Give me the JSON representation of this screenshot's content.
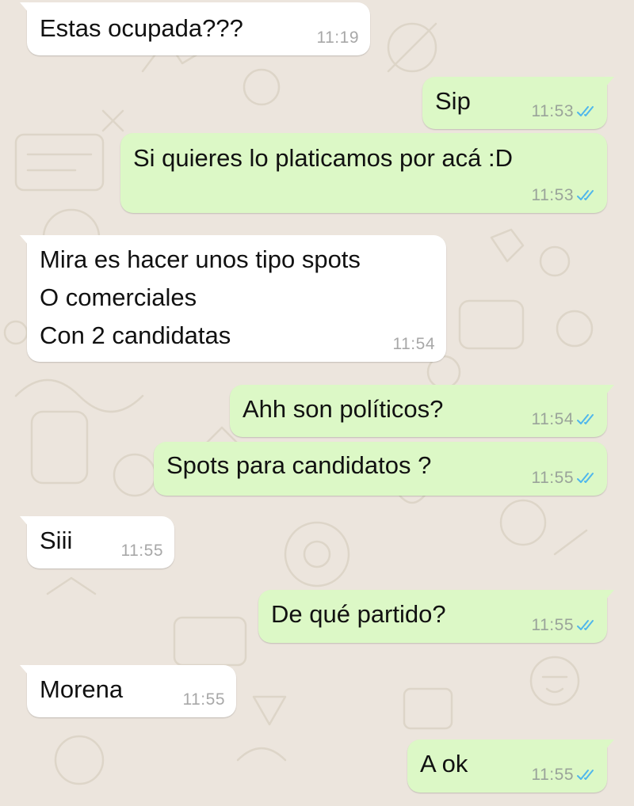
{
  "colors": {
    "wallpaper": "#ece5dd",
    "incoming_bubble": "#ffffff",
    "outgoing_bubble": "#dcf8c6",
    "read_ticks": "#4fb6ec"
  },
  "messages": [
    {
      "direction": "incoming",
      "text": "Estas ocupada???",
      "time": "11:19"
    },
    {
      "direction": "outgoing",
      "text": "Sip",
      "time": "11:53",
      "status": "read"
    },
    {
      "direction": "outgoing",
      "text": "Si quieres lo platicamos por acá :D",
      "time": "11:53",
      "status": "read"
    },
    {
      "direction": "incoming",
      "lines": [
        "Mira es hacer unos tipo spots",
        "O comerciales",
        "Con 2 candidatas"
      ],
      "time": "11:54"
    },
    {
      "direction": "outgoing",
      "text": "Ahh son políticos?",
      "time": "11:54",
      "status": "read"
    },
    {
      "direction": "outgoing",
      "text": "Spots para candidatos ?",
      "time": "11:55",
      "status": "read"
    },
    {
      "direction": "incoming",
      "text": "Siii",
      "time": "11:55"
    },
    {
      "direction": "outgoing",
      "text": "De qué partido?",
      "time": "11:55",
      "status": "read"
    },
    {
      "direction": "incoming",
      "text": "Morena",
      "time": "11:55"
    },
    {
      "direction": "outgoing",
      "text": "A ok",
      "time": "11:55",
      "status": "read"
    }
  ]
}
